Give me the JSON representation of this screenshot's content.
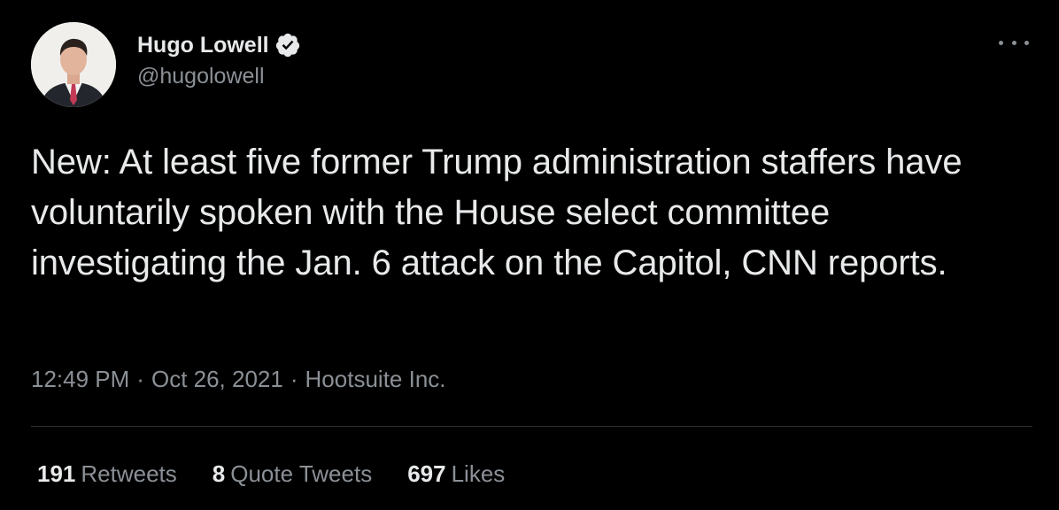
{
  "author": {
    "display_name": "Hugo Lowell",
    "handle": "@hugolowell",
    "verified": true,
    "avatar_icon": "profile-photo"
  },
  "menu": {
    "icon": "more-horizontal-icon"
  },
  "tweet": {
    "text": "New: At least five former Trump administration staffers have voluntarily spoken with the House select committee investigating the Jan. 6 attack on the Capitol, CNN reports.",
    "time": "12:49 PM",
    "separator": "·",
    "date": "Oct 26, 2021",
    "source": "Hootsuite Inc."
  },
  "stats": {
    "retweets_count": "191",
    "retweets_label": "Retweets",
    "quotes_count": "8",
    "quotes_label": "Quote Tweets",
    "likes_count": "697",
    "likes_label": "Likes"
  },
  "colors": {
    "background": "#000000",
    "primary_text": "#e7e9ea",
    "secondary_text": "#8b9096",
    "divider": "#2f3336"
  }
}
